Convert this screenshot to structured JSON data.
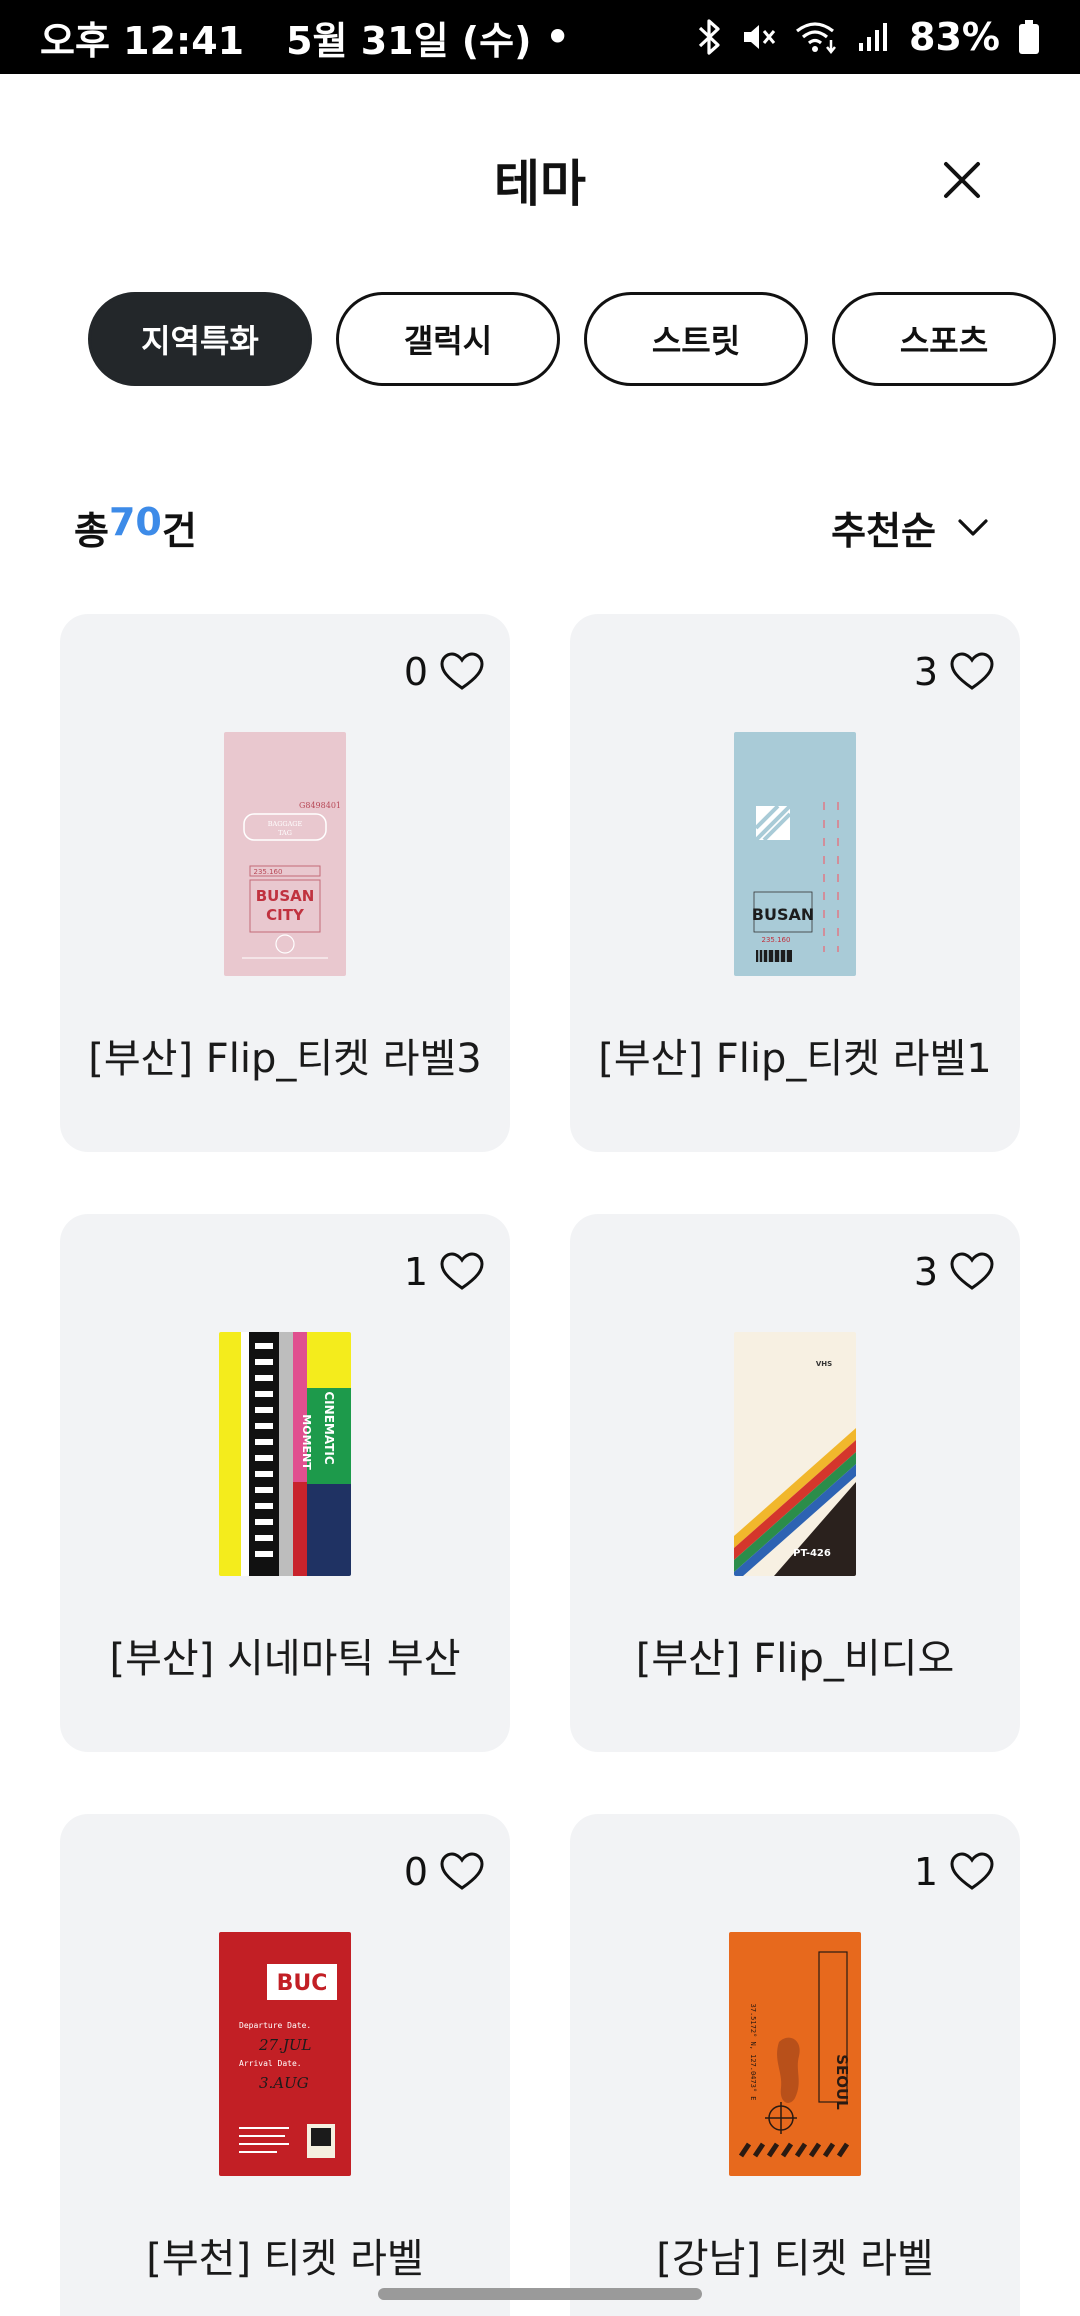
{
  "status_bar": {
    "time": "오후 12:41",
    "date": "5월 31일 (수)",
    "dot": "•",
    "battery": "83%"
  },
  "header": {
    "title": "테마"
  },
  "chips": [
    {
      "label": "지역특화",
      "active": true
    },
    {
      "label": "갤럭시",
      "active": false
    },
    {
      "label": "스트릿",
      "active": false
    },
    {
      "label": "스포츠",
      "active": false
    }
  ],
  "summary": {
    "prefix": "총",
    "count": "70",
    "suffix": "건"
  },
  "sort": {
    "label": "추천순"
  },
  "cards": [
    {
      "title": "[부산] Flip_티켓 라벨3",
      "likes": "0"
    },
    {
      "title": "[부산] Flip_티켓 라벨1",
      "likes": "3"
    },
    {
      "title": "[부산] 시네마틱 부산",
      "likes": "1"
    },
    {
      "title": "[부산] Flip_비디오",
      "likes": "3"
    },
    {
      "title": "[부천] 티켓 라벨",
      "likes": "0"
    },
    {
      "title": "[강남] 티켓 라벨",
      "likes": "1"
    }
  ],
  "thumbnails": {
    "t1": {
      "code": "G8498401",
      "lines": [
        "BAGGAGE",
        "TAG"
      ],
      "num": "235.160",
      "city1": "BUSAN",
      "city2": "CITY"
    },
    "t2": {
      "city": "BUSAN",
      "num": "235.160"
    },
    "t3": {
      "word1": "CINEMATIC",
      "word2": "MOMENT"
    },
    "t4": {
      "code": "PT-426",
      "brand": "VHS"
    },
    "t5": {
      "code": "BUC",
      "l1": "Departure Date.",
      "d1": "27.JUL",
      "l2": "Arrival Date.",
      "d2": "3.AUG"
    },
    "t6": {
      "city": "SEOUL",
      "coord": "37.5172° N, 127.0473° E"
    }
  },
  "colors": {
    "accent": "#3d8be8",
    "chip_active": "#23272a",
    "card_bg": "#f2f3f5"
  }
}
